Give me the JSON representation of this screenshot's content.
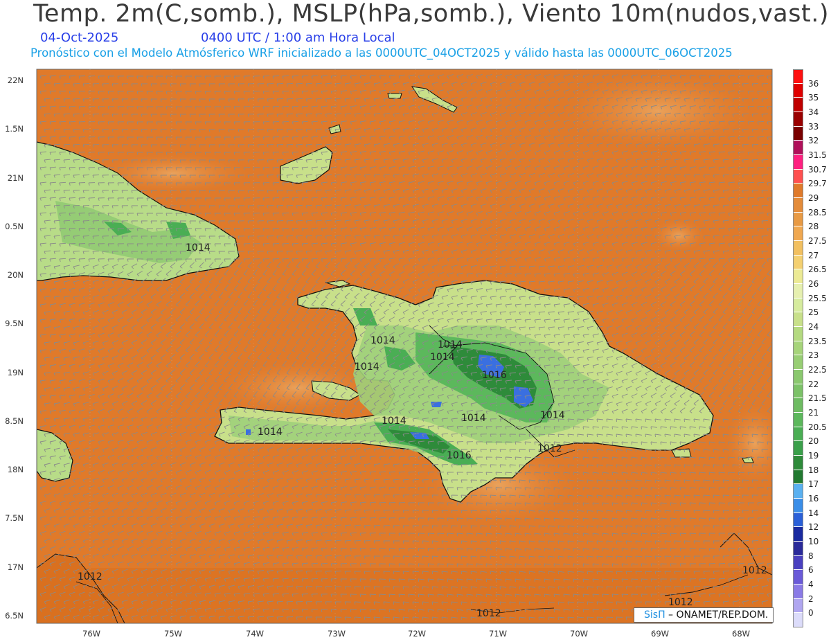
{
  "header": {
    "title": "Temp. 2m(C,somb.), MSLP(hPa,somb.), Viento 10m(nudos,vast.)",
    "date": "04-Oct-2025",
    "time": "0400 UTC / 1:00 am Hora Local",
    "forecast": "Pronóstico con el Modelo Atmósferico WRF inicializado a las 0000UTC_04OCT2025 y válido hasta las  0000UTC_06OCT2025"
  },
  "map": {
    "lat_labels": [
      "22N",
      "1.5N",
      "21N",
      "0.5N",
      "20N",
      "9.5N",
      "19N",
      "8.5N",
      "18N",
      "7.5N",
      "17N",
      "6.5N"
    ],
    "lon_labels": [
      "76W",
      "75W",
      "74W",
      "73W",
      "72W",
      "71W",
      "70W",
      "69W",
      "68W"
    ],
    "isobar_labels": [
      "1014",
      "1014",
      "1014",
      "1014",
      "1014",
      "1014",
      "1014",
      "1014",
      "1014",
      "1016",
      "1016",
      "1012",
      "1012",
      "1012",
      "1012",
      "1012"
    ],
    "colors": {
      "ocean": "#e07a2a",
      "ocean_light": "#e8923a",
      "land_warm": "#c8e08a",
      "land_mid": "#9fd07a",
      "land_cool": "#5cb85c",
      "land_cold": "#2e8b3a",
      "mountain_cold": "#3a6fe0",
      "wind_barbs": "#8a8a8a",
      "coast": "#111111"
    }
  },
  "colorbar": {
    "labels": [
      "36",
      "35",
      "34",
      "33",
      "32",
      "31.5",
      "30.7",
      "29.7",
      "29",
      "28.5",
      "28",
      "27.5",
      "27",
      "26.5",
      "26",
      "25.5",
      "25",
      "24",
      "23.5",
      "23",
      "22.5",
      "22",
      "21.5",
      "21",
      "20.5",
      "20",
      "19",
      "18",
      "17",
      "16",
      "14",
      "12",
      "10",
      "8",
      "6",
      "4",
      "2",
      "0"
    ],
    "colors": [
      "#ff1010",
      "#e00000",
      "#c00000",
      "#9a0000",
      "#7a0000",
      "#b0105a",
      "#ff2080",
      "#ff5050",
      "#e07a2a",
      "#e48c3a",
      "#e89a44",
      "#f0a850",
      "#f2c060",
      "#f4d070",
      "#ecea94",
      "#e6f0b0",
      "#d6ec9e",
      "#c8e08a",
      "#b4da80",
      "#a6d47a",
      "#98ce74",
      "#8ac86e",
      "#7cc268",
      "#6ebc62",
      "#5cb85c",
      "#4aae54",
      "#3aa04a",
      "#2e8b3a",
      "#227a30",
      "#5ab0f0",
      "#3a8ee8",
      "#2a60d8",
      "#1a2aa0",
      "#2a2a9a",
      "#4a40c0",
      "#6a5ad8",
      "#8a7ae6",
      "#b0a6f0",
      "#dcdcfa"
    ]
  },
  "credit": {
    "logo": "SisΠ",
    "text": " – ONAMET/REP.DOM."
  }
}
